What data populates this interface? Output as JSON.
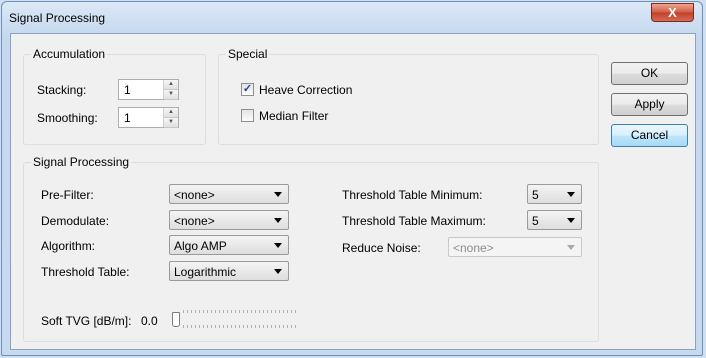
{
  "window": {
    "title": "Signal Processing",
    "close_label": "X"
  },
  "accumulation": {
    "label": "Accumulation",
    "stacking_label": "Stacking:",
    "stacking_value": "1",
    "smoothing_label": "Smoothing:",
    "smoothing_value": "1"
  },
  "special": {
    "label": "Special",
    "heave_label": "Heave Correction",
    "heave_checked": true,
    "median_label": "Median Filter",
    "median_checked": false
  },
  "buttons": {
    "ok": "OK",
    "apply": "Apply",
    "cancel": "Cancel"
  },
  "signal": {
    "label": "Signal Processing",
    "prefilter_label": "Pre-Filter:",
    "prefilter_value": "<none>",
    "demodulate_label": "Demodulate:",
    "demodulate_value": "<none>",
    "algorithm_label": "Algorithm:",
    "algorithm_value": "Algo AMP",
    "threshold_table_label": "Threshold Table:",
    "threshold_table_value": "Logarithmic",
    "tt_min_label": "Threshold Table Minimum:",
    "tt_min_value": "5",
    "tt_max_label": "Threshold Table Maximum:",
    "tt_max_value": "5",
    "reduce_noise_label": "Reduce Noise:",
    "reduce_noise_value": "<none>",
    "soft_tvg_label": "Soft TVG [dB/m]:",
    "soft_tvg_value": "0.0"
  }
}
